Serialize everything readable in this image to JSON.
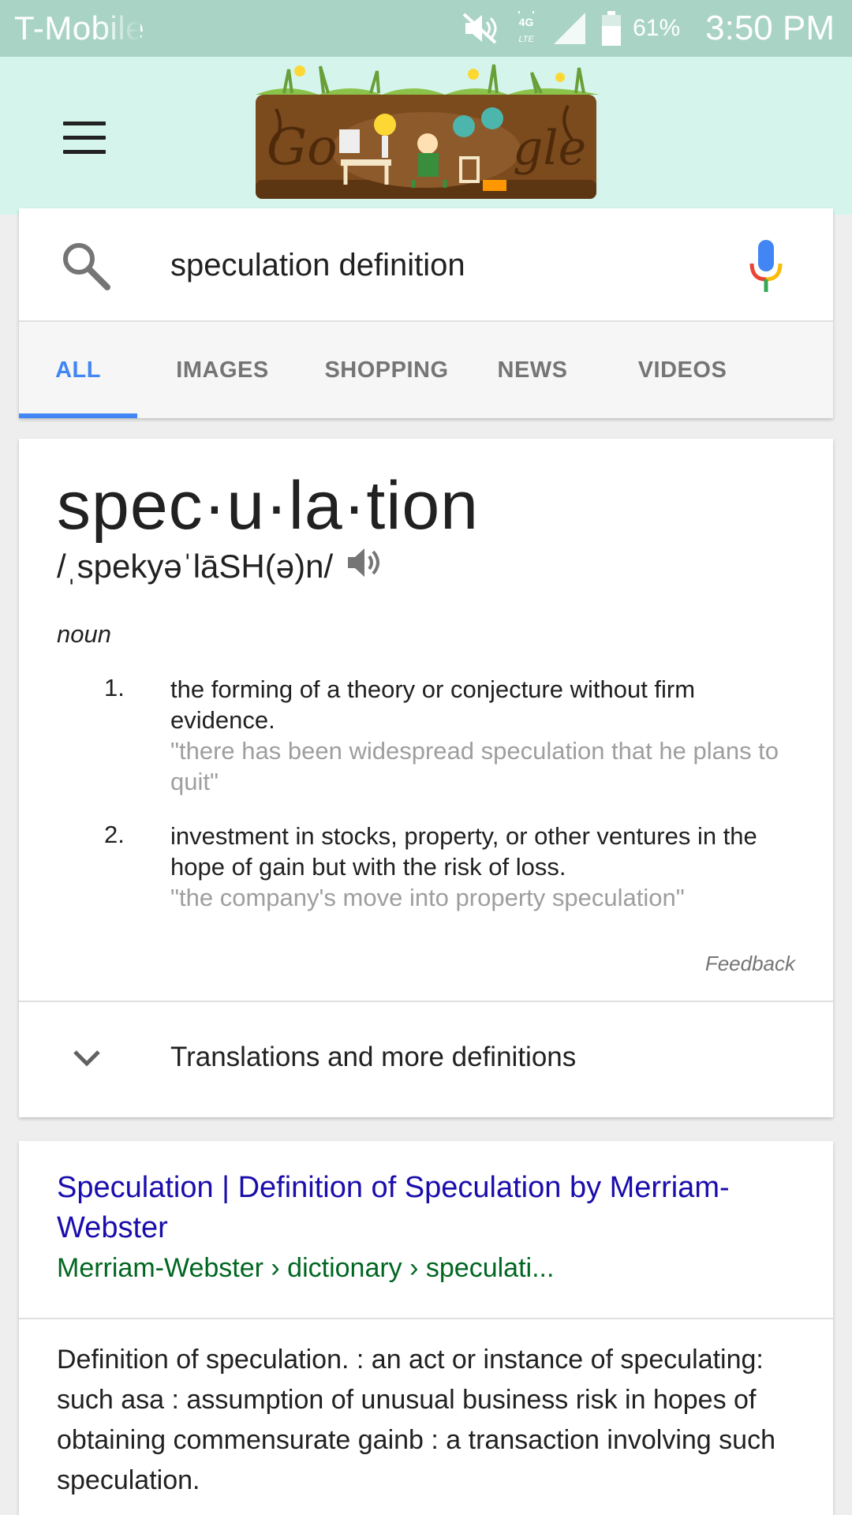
{
  "status_bar": {
    "carrier": "T-Mobile",
    "battery_percent": "61%",
    "time": "3:50 PM",
    "icons": [
      "mute-icon",
      "4g-lte-icon",
      "signal-icon",
      "battery-icon"
    ]
  },
  "header": {
    "menu_icon": "hamburger-menu-icon",
    "doodle_text": "Google"
  },
  "search": {
    "query": "speculation definition",
    "search_icon": "search-icon",
    "mic_icon": "microphone-icon"
  },
  "tabs": [
    {
      "label": "ALL",
      "active": true
    },
    {
      "label": "IMAGES",
      "active": false
    },
    {
      "label": "SHOPPING",
      "active": false
    },
    {
      "label": "NEWS",
      "active": false
    },
    {
      "label": "VIDEOS",
      "active": false
    }
  ],
  "definition": {
    "word": "spec·u·la·tion",
    "pronunciation": "/ˌspekyəˈlāSH(ə)n/",
    "part_of_speech": "noun",
    "senses": [
      {
        "number": "1.",
        "text": "the forming of a theory or conjecture without firm evidence.",
        "example": "\"there has been widespread speculation that he plans to quit\""
      },
      {
        "number": "2.",
        "text": "investment in stocks, property, or other ventures in the hope of gain but with the risk of loss.",
        "example": "\"the company's move into property speculation\""
      }
    ],
    "feedback_label": "Feedback",
    "more_label": "Translations and more definitions"
  },
  "result": {
    "title": "Speculation | Definition of Speculation by Merriam-Webster",
    "url": "Merriam-Webster › dictionary › speculati...",
    "snippet": "Definition of speculation. : an act or instance of speculating: such asa : assumption of unusual business risk in hopes of obtaining commensurate gainb : a transaction involving such speculation."
  },
  "colors": {
    "status_bar": "#a9d4c5",
    "header": "#d5f5ec",
    "tab_active": "#4285f4",
    "link": "#1a0dab",
    "url": "#006621"
  }
}
